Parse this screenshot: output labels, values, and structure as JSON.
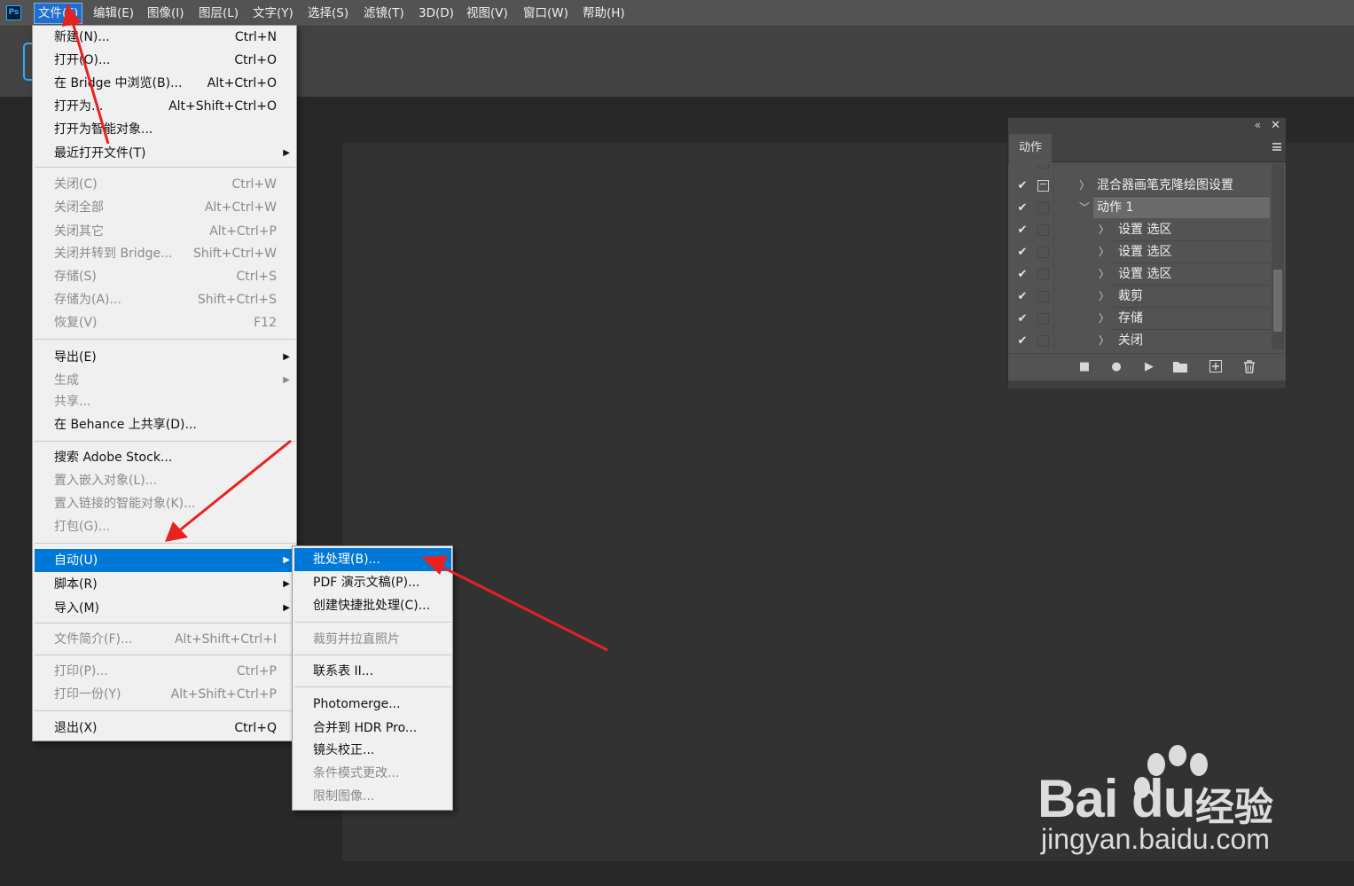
{
  "app": {
    "logo_text": "Ps"
  },
  "menubar": {
    "items": [
      {
        "label": "文件(F)"
      },
      {
        "label": "编辑(E)"
      },
      {
        "label": "图像(I)"
      },
      {
        "label": "图层(L)"
      },
      {
        "label": "文字(Y)"
      },
      {
        "label": "选择(S)"
      },
      {
        "label": "滤镜(T)"
      },
      {
        "label": "3D(D)"
      },
      {
        "label": "视图(V)"
      },
      {
        "label": "窗口(W)"
      },
      {
        "label": "帮助(H)"
      }
    ],
    "active_item": "文件(F)"
  },
  "file_menu": {
    "items": [
      {
        "label": "新建(N)...",
        "shortcut": "Ctrl+N",
        "enabled": true
      },
      {
        "label": "打开(O)...",
        "shortcut": "Ctrl+O",
        "enabled": true
      },
      {
        "label": "在 Bridge 中浏览(B)...",
        "shortcut": "Alt+Ctrl+O",
        "enabled": true
      },
      {
        "label": "打开为...",
        "shortcut": "Alt+Shift+Ctrl+O",
        "enabled": true
      },
      {
        "label": "打开为智能对象...",
        "shortcut": "",
        "enabled": true
      },
      {
        "label": "最近打开文件(T)",
        "shortcut": "",
        "enabled": true,
        "submenu": true
      },
      {
        "label": "关闭(C)",
        "shortcut": "Ctrl+W",
        "enabled": false
      },
      {
        "label": "关闭全部",
        "shortcut": "Alt+Ctrl+W",
        "enabled": false
      },
      {
        "label": "关闭其它",
        "shortcut": "Alt+Ctrl+P",
        "enabled": false
      },
      {
        "label": "关闭并转到 Bridge...",
        "shortcut": "Shift+Ctrl+W",
        "enabled": false
      },
      {
        "label": "存储(S)",
        "shortcut": "Ctrl+S",
        "enabled": false
      },
      {
        "label": "存储为(A)...",
        "shortcut": "Shift+Ctrl+S",
        "enabled": false
      },
      {
        "label": "恢复(V)",
        "shortcut": "F12",
        "enabled": false
      },
      {
        "label": "导出(E)",
        "shortcut": "",
        "enabled": true,
        "submenu": true
      },
      {
        "label": "生成",
        "shortcut": "",
        "enabled": false,
        "submenu": true
      },
      {
        "label": "共享...",
        "shortcut": "",
        "enabled": false
      },
      {
        "label": "在 Behance 上共享(D)...",
        "shortcut": "",
        "enabled": true
      },
      {
        "label": "搜索 Adobe Stock...",
        "shortcut": "",
        "enabled": true
      },
      {
        "label": "置入嵌入对象(L)...",
        "shortcut": "",
        "enabled": false
      },
      {
        "label": "置入链接的智能对象(K)...",
        "shortcut": "",
        "enabled": false
      },
      {
        "label": "打包(G)...",
        "shortcut": "",
        "enabled": false
      },
      {
        "label": "自动(U)",
        "shortcut": "",
        "enabled": true,
        "submenu": true,
        "highlighted": true
      },
      {
        "label": "脚本(R)",
        "shortcut": "",
        "enabled": true,
        "submenu": true
      },
      {
        "label": "导入(M)",
        "shortcut": "",
        "enabled": true,
        "submenu": true
      },
      {
        "label": "文件简介(F)...",
        "shortcut": "Alt+Shift+Ctrl+I",
        "enabled": false
      },
      {
        "label": "打印(P)...",
        "shortcut": "Ctrl+P",
        "enabled": false
      },
      {
        "label": "打印一份(Y)",
        "shortcut": "Alt+Shift+Ctrl+P",
        "enabled": false
      },
      {
        "label": "退出(X)",
        "shortcut": "Ctrl+Q",
        "enabled": true
      }
    ]
  },
  "auto_submenu": {
    "items": [
      {
        "label": "批处理(B)...",
        "enabled": true,
        "highlighted": true
      },
      {
        "label": "PDF 演示文稿(P)...",
        "enabled": true
      },
      {
        "label": "创建快捷批处理(C)...",
        "enabled": true
      },
      {
        "label": "裁剪并拉直照片",
        "enabled": false
      },
      {
        "label": "联系表 II...",
        "enabled": true
      },
      {
        "label": "Photomerge...",
        "enabled": true
      },
      {
        "label": "合并到 HDR Pro...",
        "enabled": true
      },
      {
        "label": "镜头校正...",
        "enabled": true
      },
      {
        "label": "条件模式更改...",
        "enabled": false
      },
      {
        "label": "限制图像...",
        "enabled": false
      }
    ]
  },
  "actions_panel": {
    "tab_label": "动作",
    "rows": [
      {
        "label": "混合器画笔克隆绘图设置",
        "level": 0,
        "expanded": false,
        "dialog": true
      },
      {
        "label": "动作 1",
        "level": 0,
        "expanded": true,
        "dialog": false,
        "selected": true
      },
      {
        "label": "设置 选区",
        "level": 1
      },
      {
        "label": "设置 选区",
        "level": 1
      },
      {
        "label": "设置 选区",
        "level": 1
      },
      {
        "label": "裁剪",
        "level": 1
      },
      {
        "label": "存储",
        "level": 1
      },
      {
        "label": "关闭",
        "level": 1
      }
    ],
    "footer_icons": [
      "stop-icon",
      "record-icon",
      "play-icon",
      "folder-icon",
      "new-action-icon",
      "trash-icon"
    ]
  },
  "watermark": {
    "brand": "Bai du",
    "jingyan": "经验",
    "url": "jingyan.baidu.com"
  },
  "colors": {
    "menubar": "#535353",
    "menu_bg": "#f0f0f0",
    "highlight": "#0078d7",
    "accent": "#31a8ff",
    "arrow": "#e8221f"
  }
}
